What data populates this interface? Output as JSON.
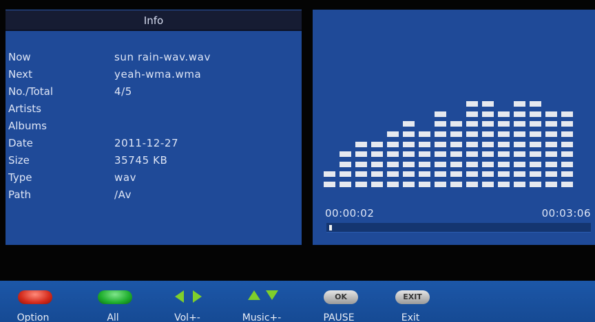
{
  "info": {
    "title": "Info",
    "rows": [
      {
        "label": "Now",
        "value": "sun rain-wav.wav"
      },
      {
        "label": "Next",
        "value": "yeah-wma.wma"
      },
      {
        "label": "No./Total",
        "value": "4/5"
      },
      {
        "label": "Artists",
        "value": ""
      },
      {
        "label": "Albums",
        "value": ""
      },
      {
        "label": "Date",
        "value": "2011-12-27"
      },
      {
        "label": "Size",
        "value": "35745 KB"
      },
      {
        "label": "Type",
        "value": "wav"
      },
      {
        "label": "Path",
        "value": "/Av"
      }
    ]
  },
  "player": {
    "elapsed": "00:00:02",
    "total": "00:03:06",
    "progress_fraction": 0.011,
    "spectrum_levels": [
      2,
      4,
      5,
      5,
      6,
      7,
      6,
      8,
      7,
      9,
      9,
      8,
      9,
      9,
      8,
      8
    ],
    "spectrum_max": 10
  },
  "controls": {
    "option": {
      "label": "Option",
      "color": "#d42b1c"
    },
    "all": {
      "label": "All",
      "color": "#1fae2d"
    },
    "vol": {
      "label": "Vol+-"
    },
    "music": {
      "label": "Music+-"
    },
    "ok": {
      "key": "OK",
      "label": "PAUSE"
    },
    "exit": {
      "key": "EXIT",
      "label": "Exit"
    }
  }
}
